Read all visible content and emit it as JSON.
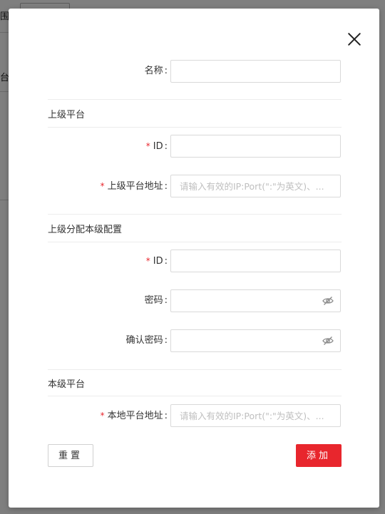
{
  "background": {
    "fragment_top": "围",
    "fragment_mid": "台"
  },
  "form": {
    "name": {
      "label": "名称",
      "value": ""
    },
    "sections": {
      "superior_platform": "上级平台",
      "superior_assign_local": "上级分配本级配置",
      "local_platform": "本级平台"
    },
    "superior_id": {
      "label": "ID",
      "value": ""
    },
    "superior_address": {
      "label": "上级平台地址",
      "placeholder": "请输入有效的IP:Port(\":\"为英文)、..."
    },
    "local_id": {
      "label": "ID",
      "value": ""
    },
    "password": {
      "label": "密码",
      "value": ""
    },
    "confirm_password": {
      "label": "确认密码",
      "value": ""
    },
    "local_address": {
      "label": "本地平台地址",
      "placeholder": "请输入有效的IP:Port(\":\"为英文)、..."
    },
    "colon": ":",
    "required_mark": "*"
  },
  "buttons": {
    "reset": "重置",
    "add": "添加"
  },
  "colors": {
    "primary": "#e8262d",
    "overlay": "#7f7f7f"
  },
  "icons": {
    "close": "close-icon",
    "eye": "eye-off-icon"
  }
}
